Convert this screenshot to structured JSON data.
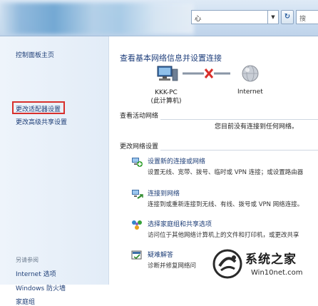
{
  "address_bar": {
    "path_text": "心",
    "dropdown_icon": "chevron-down-icon",
    "refresh_icon": "refresh-icon",
    "search_text": "搜"
  },
  "sidebar": {
    "items": [
      {
        "label": "控制面板主页"
      },
      {
        "label": "更改适配器设置",
        "highlighted": true
      },
      {
        "label": "更改高级共享设置"
      }
    ],
    "see_also_title": "另请参阅",
    "see_also": [
      {
        "label": "Internet 选项"
      },
      {
        "label": "Windows 防火墙"
      },
      {
        "label": "家庭组"
      }
    ]
  },
  "main": {
    "title": "查看基本网络信息并设置连接",
    "map": {
      "pc_name": "KKK-PC",
      "pc_sub": "(此计算机)",
      "internet_label": "Internet",
      "link_status": "disconnected"
    },
    "active_networks": {
      "heading": "查看活动网络",
      "status": "您目前没有连接到任何网络。"
    },
    "change_settings": {
      "heading": "更改网络设置",
      "tasks": [
        {
          "icon": "new-connection-icon",
          "link": "设置新的连接或网络",
          "desc": "设置无线、宽带、拨号、临时或 VPN 连接；或设置路由器"
        },
        {
          "icon": "connect-network-icon",
          "link": "连接到网络",
          "desc": "连接到或重新连接到无线、有线、拨号或 VPN 网络连接。"
        },
        {
          "icon": "homegroup-icon",
          "link": "选择家庭组和共享选项",
          "desc": "访问位于其他网络计算机上的文件和打印机，或更改共享"
        },
        {
          "icon": "troubleshoot-icon",
          "link": "疑难解答",
          "desc": "诊断并修复网络问"
        }
      ]
    }
  },
  "watermark": {
    "brand": "系统之家",
    "url": "Win10net.com"
  },
  "colors": {
    "link": "#1f3f78",
    "highlight_border": "#d8302c",
    "sidebar_bg": "#e8f0f9",
    "error_x": "#d8302c"
  }
}
